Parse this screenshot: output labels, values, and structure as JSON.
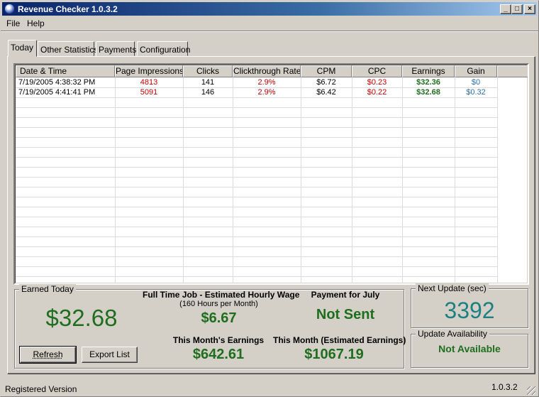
{
  "window": {
    "title": "Revenue Checker 1.0.3.2",
    "minimize_label": "_",
    "maximize_label": "□",
    "close_label": "×"
  },
  "menu": {
    "file": "File",
    "help": "Help"
  },
  "tabs": [
    "Today",
    "Other Statistics",
    "Payments",
    "Configuration"
  ],
  "table": {
    "columns": [
      "Date & Time",
      "Page Impressions",
      "Clicks",
      "Clickthrough Rate",
      "CPM",
      "CPC",
      "Earnings",
      "Gain"
    ],
    "rows": [
      [
        "7/19/2005 4:38:32 PM",
        "4813",
        "141",
        "2.9%",
        "$6.72",
        "$0.23",
        "$32.36",
        "$0"
      ],
      [
        "7/19/2005 4:41:41 PM",
        "5091",
        "146",
        "2.9%",
        "$6.42",
        "$0.22",
        "$32.68",
        "$0.32"
      ]
    ]
  },
  "earned_today": {
    "title": "Earned Today",
    "amount": "$32.68",
    "refresh_label": "Refresh",
    "export_label": "Export List",
    "hourly_title": "Full Time Job - Estimated Hourly Wage",
    "hourly_sub": "(160 Hours per Month)",
    "hourly_value": "$6.67",
    "payment_title": "Payment for July",
    "payment_value": "Not Sent",
    "month_title": "This Month's Earnings",
    "month_value": "$642.61",
    "month_est_title": "This Month (Estimated Earnings)",
    "month_est_value": "$1067.19"
  },
  "next_update": {
    "title": "Next Update  (sec)",
    "value": "3392"
  },
  "update_availability": {
    "title": "Update Availability",
    "value": "Not Available"
  },
  "status": {
    "left": "Registered Version",
    "right": "1.0.3.2"
  },
  "colors": {
    "red": "#c00000",
    "green": "#1e6e1e",
    "teal": "#1e8080",
    "blue_gain": "#2a6fa8"
  }
}
